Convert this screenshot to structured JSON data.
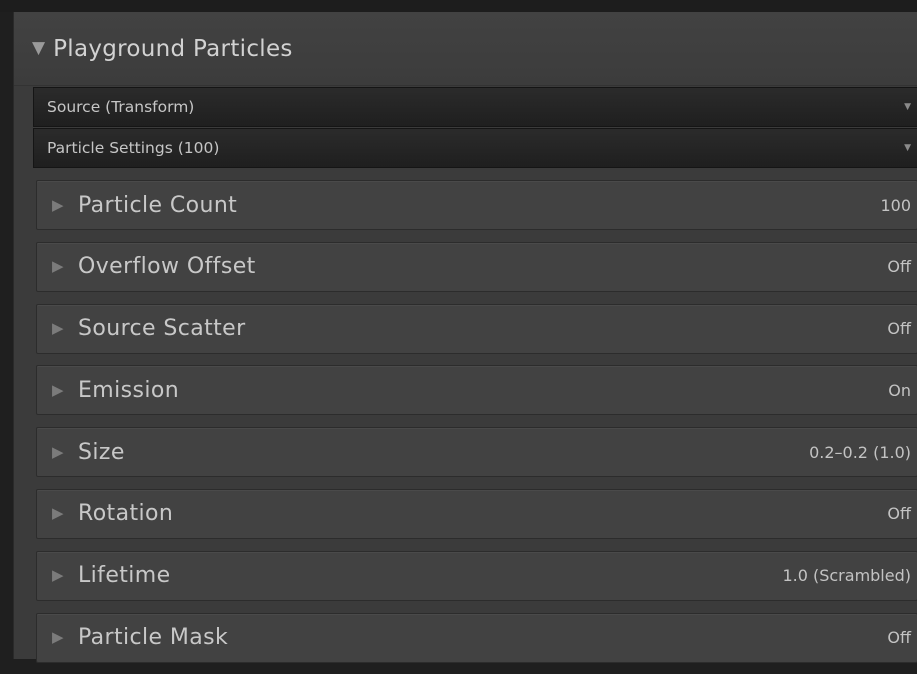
{
  "component": {
    "title": "Playground Particles"
  },
  "dropdowns": [
    {
      "label": "Source (Transform)"
    },
    {
      "label": "Particle Settings (100)"
    }
  ],
  "settings": [
    {
      "label": "Particle Count",
      "value": "100"
    },
    {
      "label": "Overflow Offset",
      "value": "Off"
    },
    {
      "label": "Source Scatter",
      "value": "Off"
    },
    {
      "label": "Emission",
      "value": "On"
    },
    {
      "label": "Size",
      "value": "0.2–0.2 (1.0)"
    },
    {
      "label": "Rotation",
      "value": "Off"
    },
    {
      "label": "Lifetime",
      "value": "1.0 (Scrambled)"
    },
    {
      "label": "Particle Mask",
      "value": "Off"
    }
  ],
  "icons": {
    "expanded": "triangle-down-icon",
    "collapsed": "triangle-right-icon",
    "dropdown": "dropdown-arrow-icon"
  }
}
